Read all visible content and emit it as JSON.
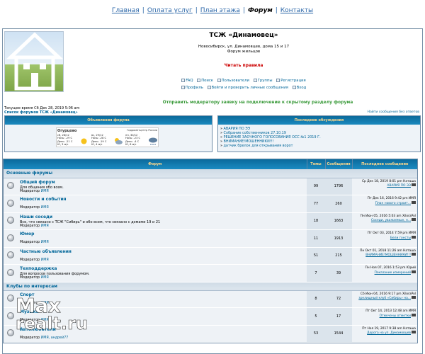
{
  "nav": {
    "items": [
      "Главная",
      "Оплата услуг",
      "План этажа",
      "Форум",
      "Контакты"
    ],
    "active_index": 3,
    "separator": "|"
  },
  "header": {
    "title": "ТСЖ «Динамовец»",
    "address": "Новосибирск, ул. Динамовцев, дома 15 и 17",
    "subtitle": "Форум жильцов",
    "rules_link": "Читать правила",
    "menu_row1": [
      "FAQ",
      "Поиск",
      "Пользователи",
      "Группы",
      "Регистрация"
    ],
    "menu_row2": [
      "Профиль",
      "Войти и проверить личные сообщения",
      "Вход"
    ]
  },
  "request_text": "Отправить модератору заявку на подключение к скрытому разделу форума",
  "current_time": "Текущее время Сб Дек 28, 2019 5:06 am",
  "forum_list_link": "Список форумов ТСЖ «Динамовец»",
  "new_posts_link": "Найти сообщения без ответов",
  "ads_panel": {
    "title": "Объявления форума",
    "weather": {
      "place": "Огурцово",
      "provider": "Гидрометцентр России",
      "days": [
        {
          "day": "сб, 28/12",
          "line1": "Ночь: -29 С",
          "line2": "День: -21 С",
          "wind": "Ю, 3 м/с"
        },
        {
          "day": "вс, 29/12",
          "line1": "Ночь: -28 С",
          "line2": "День: -19 С",
          "wind": "Ю, 4 м/с"
        },
        {
          "day": "пн, 30/12",
          "line1": "Ночь: -23 С",
          "line2": "День: -4 С",
          "wind": "Ю, 6 м/с"
        }
      ]
    }
  },
  "recent_panel": {
    "title": "Последние обсуждения",
    "items": [
      "АВАРИЯ ПО ЭЭ",
      "Собрание собственников 27.10.19",
      "РЕШЕНИЕ ЗАОЧНОГО ГОЛОСОВАНИЯ ОСС №1 2019 Г.",
      "ВНИМАНИЕ!МОШЕННИКИ!!!",
      "датчик брелок для открывания ворот"
    ]
  },
  "table": {
    "col_forum": "Форум",
    "col_topics": "Темы",
    "col_posts": "Сообщения",
    "col_last": "Последнее сообщение"
  },
  "categories": [
    {
      "name": "Основные форумы",
      "forums": [
        {
          "name": "Общий форум",
          "desc": "Для общения обо всем.",
          "mod_label": "Модератор",
          "mod": "ИМЯ",
          "topics": "99",
          "posts": "1796",
          "last_date": "Ср Дек 18, 2019 8:01 pm Наташа",
          "last_link": "АВАРИЯ ПО ЭЭ"
        },
        {
          "name": "Новости и события",
          "desc": "",
          "mod_label": "Модератор",
          "mod": "ИМЯ",
          "topics": "77",
          "posts": "260",
          "last_date": "Пт Дек 16, 2016 9:42 pm ИМЯ",
          "last_link": "План нового строит..."
        },
        {
          "name": "Наши соседи",
          "desc": "Все, что связано с ТСЖ \"Сибирь\" и обо всем, что связано с домами 19 и 21",
          "mod_label": "Модератор",
          "mod": "ИМЯ",
          "topics": "18",
          "posts": "1663",
          "last_date": "Пн Июн 05, 2016 5:03 am XiloraPol",
          "last_link": "Соседи, уважаемые, н..."
        },
        {
          "name": "Юмор",
          "desc": "",
          "mod_label": "Модератор",
          "mod": "ИМЯ",
          "topics": "11",
          "posts": "1913",
          "last_date": "Пт Окт 03, 2014 7:59 pm ИМЯ",
          "last_link": "Бели гонсты"
        },
        {
          "name": "Частные объявления",
          "desc": "",
          "mod_label": "Модератор",
          "mod": "ИМЯ",
          "topics": "51",
          "posts": "215",
          "last_date": "Пн Окт 01, 2018 11:26 am Наташа",
          "last_link": "ВНИМАНИЕ!МОШЕННИКИ!!!"
        },
        {
          "name": "Техподдержка",
          "desc": "Для вопросов пользования форумом.",
          "mod_label": "Модератор",
          "mod": "ИМЯ",
          "topics": "7",
          "posts": "39",
          "last_date": "Пн Ноя 07, 2016 1:53 pm Юрий",
          "last_link": "Показание измерений"
        }
      ]
    },
    {
      "name": "Клубы по интересам",
      "forums": [
        {
          "name": "Спорт",
          "desc": "",
          "mod_label": "Модератор",
          "mod": "ИМЯ",
          "topics": "8",
          "posts": "72",
          "last_date": "Сб Июн 04, 2016 9:17 pm XiloraPol",
          "last_link": "зрелищный клуб «Сибирь» на..."
        },
        {
          "name": "Музыка",
          "desc": "",
          "mod_label": "Модератор",
          "mod": "ИМЯ",
          "topics": "5",
          "posts": "17",
          "last_date": "Пт Окт 14, 2013 12:48 am ИМЯ",
          "last_link": "Отмечены отметки"
        },
        {
          "name": "Автолюбители",
          "desc": "",
          "mod_label": "Модератор",
          "mod": "ИМЯ, андрей77",
          "topics": "53",
          "posts": "1544",
          "last_date": "Пт Ноя 19, 2017 9:38 am Наташа",
          "last_link": "Дорога на ул. Динамовцев"
        }
      ]
    }
  ],
  "watermark": {
    "line1": "Max",
    "line2": "realt.ru"
  }
}
